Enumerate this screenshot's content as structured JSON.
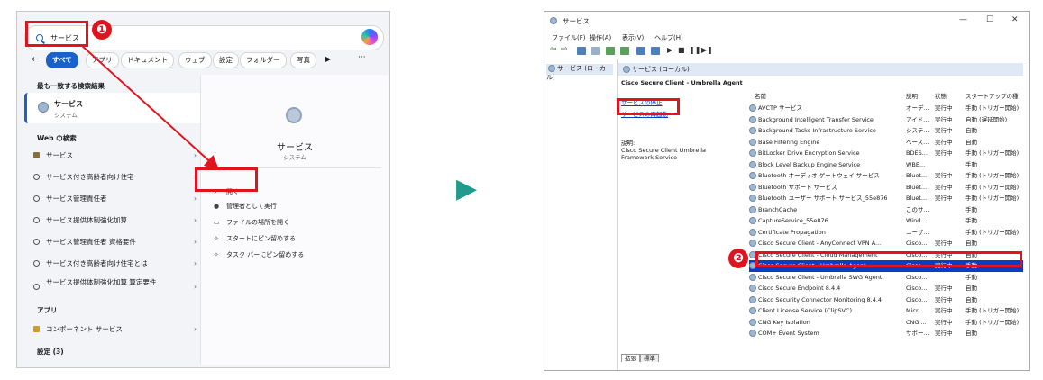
{
  "search": {
    "query": "サービス",
    "filters": [
      "すべて",
      "アプリ",
      "ドキュメント",
      "ウェブ",
      "設定",
      "フォルダー",
      "写真"
    ],
    "best_match_title": "最も一致する検索結果",
    "best_match": {
      "name": "サービス",
      "type": "システム"
    },
    "web_title": "Web の検索",
    "web_results": [
      "サービス",
      "サービス付き高齢者向け住宅",
      "サービス管理責任者",
      "サービス提供体制強化加算",
      "サービス管理責任者 資格要件",
      "サービス付き高齢者向け住宅とは",
      "サービス提供体制強化加算 算定要件"
    ],
    "apps_title": "アプリ",
    "app_results": [
      "コンポーネント サービス"
    ],
    "settings_title": "設定 (3)",
    "preview": {
      "name": "サービス",
      "type": "システム"
    },
    "actions": [
      "開く",
      "管理者として実行",
      "ファイルの場所を開く",
      "スタートにピン留めする",
      "タスク バーにピン留めする"
    ]
  },
  "annotations": {
    "step1": "❶",
    "step2": "❷"
  },
  "arrow_glyph": "▶",
  "services": {
    "title": "サービス",
    "menu": [
      "ファイル(F)",
      "操作(A)",
      "表示(V)",
      "ヘルプ(H)"
    ],
    "tree_item": "サービス (ローカル)",
    "header": "サービス (ローカル)",
    "selected_name": "Cisco Secure Client - Umbrella Agent",
    "links": [
      "サービスの停止",
      "サービスの再起動"
    ],
    "desc_label": "説明:",
    "desc_text": "Cisco Secure Client Umbrella Framework Service",
    "columns": [
      "名前",
      "説明",
      "状態",
      "スタートアップの種"
    ],
    "rows": [
      [
        "AVCTP サービス",
        "オーデ...",
        "実行中",
        "手動 (トリガー開始)"
      ],
      [
        "Background Intelligent Transfer Service",
        "アイド...",
        "実行中",
        "自動 (遅延開始)"
      ],
      [
        "Background Tasks Infrastructure Service",
        "システ...",
        "実行中",
        "自動"
      ],
      [
        "Base Filtering Engine",
        "ベース...",
        "実行中",
        "自動"
      ],
      [
        "BitLocker Drive Encryption Service",
        "BDES...",
        "実行中",
        "手動 (トリガー開始)"
      ],
      [
        "Block Level Backup Engine Service",
        "WBE...",
        "",
        "手動"
      ],
      [
        "Bluetooth オーディオ ゲートウェイ サービス",
        "Bluet...",
        "実行中",
        "手動 (トリガー開始)"
      ],
      [
        "Bluetooth サポート サービス",
        "Bluet...",
        "実行中",
        "手動 (トリガー開始)"
      ],
      [
        "Bluetooth ユーザー サポート サービス_55e876",
        "Bluet...",
        "実行中",
        "手動 (トリガー開始)"
      ],
      [
        "BranchCache",
        "このサ...",
        "",
        "手動"
      ],
      [
        "CaptureService_55e876",
        "Wind...",
        "",
        "手動"
      ],
      [
        "Certificate Propagation",
        "ユーザ...",
        "",
        "手動 (トリガー開始)"
      ],
      [
        "Cisco Secure Client - AnyConnect VPN A...",
        "Cisco...",
        "実行中",
        "自動"
      ],
      [
        "Cisco Secure Client - Cloud Management",
        "Cisco...",
        "実行中",
        "自動"
      ],
      [
        "Cisco Secure Client - Umbrella Agent",
        "Cisco...",
        "実行中",
        "手動"
      ],
      [
        "Cisco Secure Client - Umbrella SWG Agent",
        "Cisco...",
        "",
        "手動"
      ],
      [
        "Cisco Secure Endpoint 8.4.4",
        "Cisco...",
        "実行中",
        "自動"
      ],
      [
        "Cisco Security Connector Monitoring 8.4.4",
        "Cisco...",
        "実行中",
        "自動"
      ],
      [
        "Client License Service (ClipSVC)",
        "Micr...",
        "実行中",
        "手動 (トリガー開始)"
      ],
      [
        "CNG Key Isolation",
        "CNG ...",
        "実行中",
        "手動 (トリガー開始)"
      ],
      [
        "COM+ Event System",
        "サポー...",
        "実行中",
        "自動"
      ]
    ],
    "tabs": [
      "拡張",
      "標準"
    ]
  }
}
